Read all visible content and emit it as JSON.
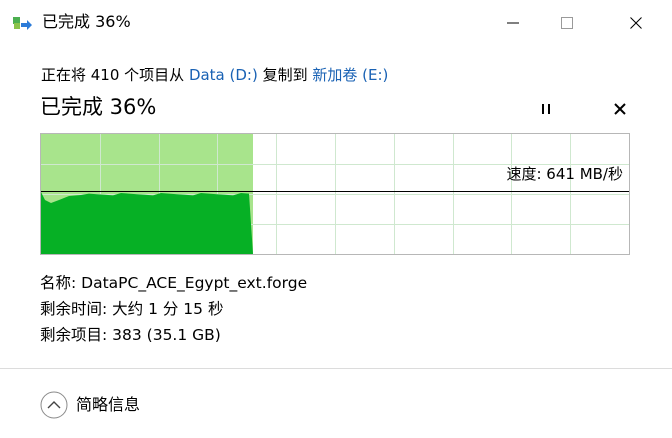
{
  "window": {
    "title": "已完成 36%",
    "icons": [
      "copy-app-icon",
      "minimize-icon",
      "maximize-icon",
      "close-icon"
    ]
  },
  "copy": {
    "prefix": "正在将 410 个项目从 ",
    "source": "Data (D:)",
    "middle": " 复制到 ",
    "destination": "新加卷 (E:)"
  },
  "progress": {
    "label": "已完成 36%",
    "fraction": 0.36,
    "speed_label": "速度: 641 MB/秒",
    "pause_icon": "pause-icon",
    "cancel_icon": "cancel-icon"
  },
  "details": {
    "name_line": "名称: DataPC_ACE_Egypt_ext.forge",
    "time_line": "剩余时间: 大约 1 分 15 秒",
    "items_line": "剩余项目: 383 (35.1 GB)"
  },
  "footer": {
    "toggle_label": "简略信息",
    "toggle_icon": "chevron-up-icon"
  },
  "colors": {
    "link": "#1a62b4",
    "graph_fill_dark": "#06b025",
    "graph_fill_light": "#a8e48c",
    "grid": "#cfe8cf"
  }
}
